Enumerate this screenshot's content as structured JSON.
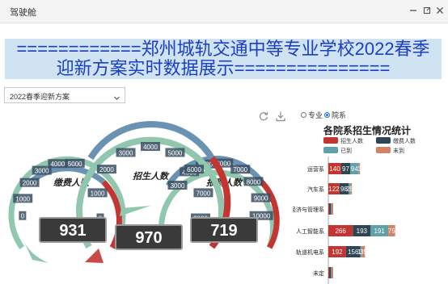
{
  "window": {
    "title": "驾驶舱"
  },
  "banner": {
    "line1": "============郑州城轨交通中等专业学校2022春季",
    "line2": "迎新方案实时数据展示==============="
  },
  "plan_select": {
    "value": "2022春季迎新方案"
  },
  "radio": {
    "option_major": "专业",
    "option_dept": "院系"
  },
  "gauges": {
    "left": {
      "title": "缴费人数",
      "value": "931",
      "ticks": [
        "0",
        "1000",
        "2000",
        "3000",
        "4000",
        "5000"
      ]
    },
    "center": {
      "title": "招生人数",
      "value": "970",
      "ticks": [
        "0",
        "1000",
        "2000",
        "3000",
        "4000",
        "5000",
        "6000",
        "7000",
        "8000"
      ]
    },
    "right": {
      "title": "报到人数",
      "value": "719",
      "ticks": [
        "3000",
        "4000",
        "5000",
        "6000",
        "7000",
        "8000",
        "9000",
        "10000"
      ]
    }
  },
  "colors": {
    "navy": "#2e4a63",
    "red": "#c23531",
    "teal": "#61a0a8",
    "orange": "#d48265",
    "gauge_blue": "#6a93b3",
    "gauge_green": "#91c7ae"
  },
  "chart_data": {
    "type": "bar",
    "title": "各院系招生情况统计",
    "legend": [
      "招生人数",
      "缴费人数",
      "已到",
      "未到"
    ],
    "categories": [
      "运营系",
      "汽车系",
      "经济与管理系",
      "人工智能系",
      "轨道机电系",
      "未定"
    ],
    "series": [
      {
        "name": "招生人数",
        "values": [
          140,
          122,
          6,
          266,
          192,
          9
        ]
      },
      {
        "name": "缴费人数",
        "values": [
          97,
          98,
          4,
          193,
          156,
          3
        ]
      },
      {
        "name": "已到",
        "values": [
          94,
          23,
          2,
          191,
          15,
          3
        ]
      },
      {
        "name": "未到",
        "values": [
          3,
          5,
          2,
          75,
          35,
          3
        ]
      }
    ],
    "value_labels": [
      [
        "140",
        "97",
        "94",
        "3"
      ],
      [
        "122",
        "98",
        "23",
        "5"
      ],
      [
        "",
        "",
        "",
        ""
      ],
      [
        "266",
        "193",
        "191",
        "75"
      ],
      [
        "192",
        "156",
        "15",
        "35"
      ],
      [
        "",
        "",
        "",
        ""
      ]
    ]
  }
}
